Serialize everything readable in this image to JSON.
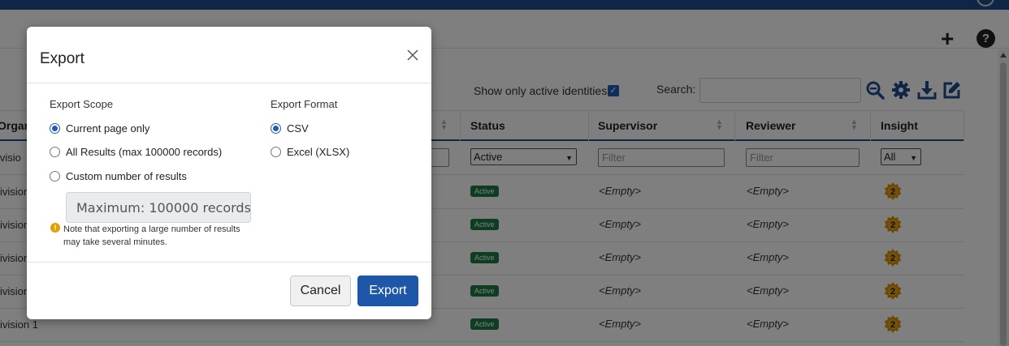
{
  "toolbar": {
    "show_active_label": "Show only active identities",
    "search_label": "Search:"
  },
  "table": {
    "columns": [
      "Organi",
      "Status",
      "Supervisor",
      "Reviewer",
      "Insight"
    ],
    "filters": {
      "status_value": "Active",
      "supervisor_placeholder": "Filter",
      "reviewer_placeholder": "Filter",
      "insight_value": "All"
    },
    "rows": [
      {
        "org": "ivision",
        "status": "Active",
        "supervisor": "<Empty>",
        "reviewer": "<Empty>",
        "insight": "2"
      },
      {
        "org": "ivision",
        "status": "Active",
        "supervisor": "<Empty>",
        "reviewer": "<Empty>",
        "insight": "2"
      },
      {
        "org": "ivision",
        "status": "Active",
        "supervisor": "<Empty>",
        "reviewer": "<Empty>",
        "insight": "2"
      },
      {
        "org": "ivision",
        "status": "Active",
        "supervisor": "<Empty>",
        "reviewer": "<Empty>",
        "insight": "2"
      },
      {
        "org": "ivision 1",
        "status": "Active",
        "supervisor": "<Empty>",
        "reviewer": "<Empty>",
        "insight": "2"
      }
    ],
    "first_filter_org": "ivisio"
  },
  "modal": {
    "title": "Export",
    "scope": {
      "title": "Export Scope",
      "options": [
        {
          "label": "Current page only",
          "checked": true
        },
        {
          "label": "All Results (max 100000 records)",
          "checked": false
        },
        {
          "label": "Custom number of results",
          "checked": false
        }
      ],
      "custom_placeholder": "Maximum: 100000 records",
      "note": "Note that exporting a large number of results may take several minutes."
    },
    "format": {
      "title": "Export Format",
      "options": [
        {
          "label": "CSV",
          "checked": true
        },
        {
          "label": "Excel (XLSX)",
          "checked": false
        }
      ]
    },
    "cancel_label": "Cancel",
    "export_label": "Export"
  },
  "colors": {
    "brand": "#1f4e8c",
    "primary_button": "#1f57a8",
    "status_active": "#1d7a45",
    "insight_badge": "#d4900a",
    "warning": "#e0a100"
  }
}
